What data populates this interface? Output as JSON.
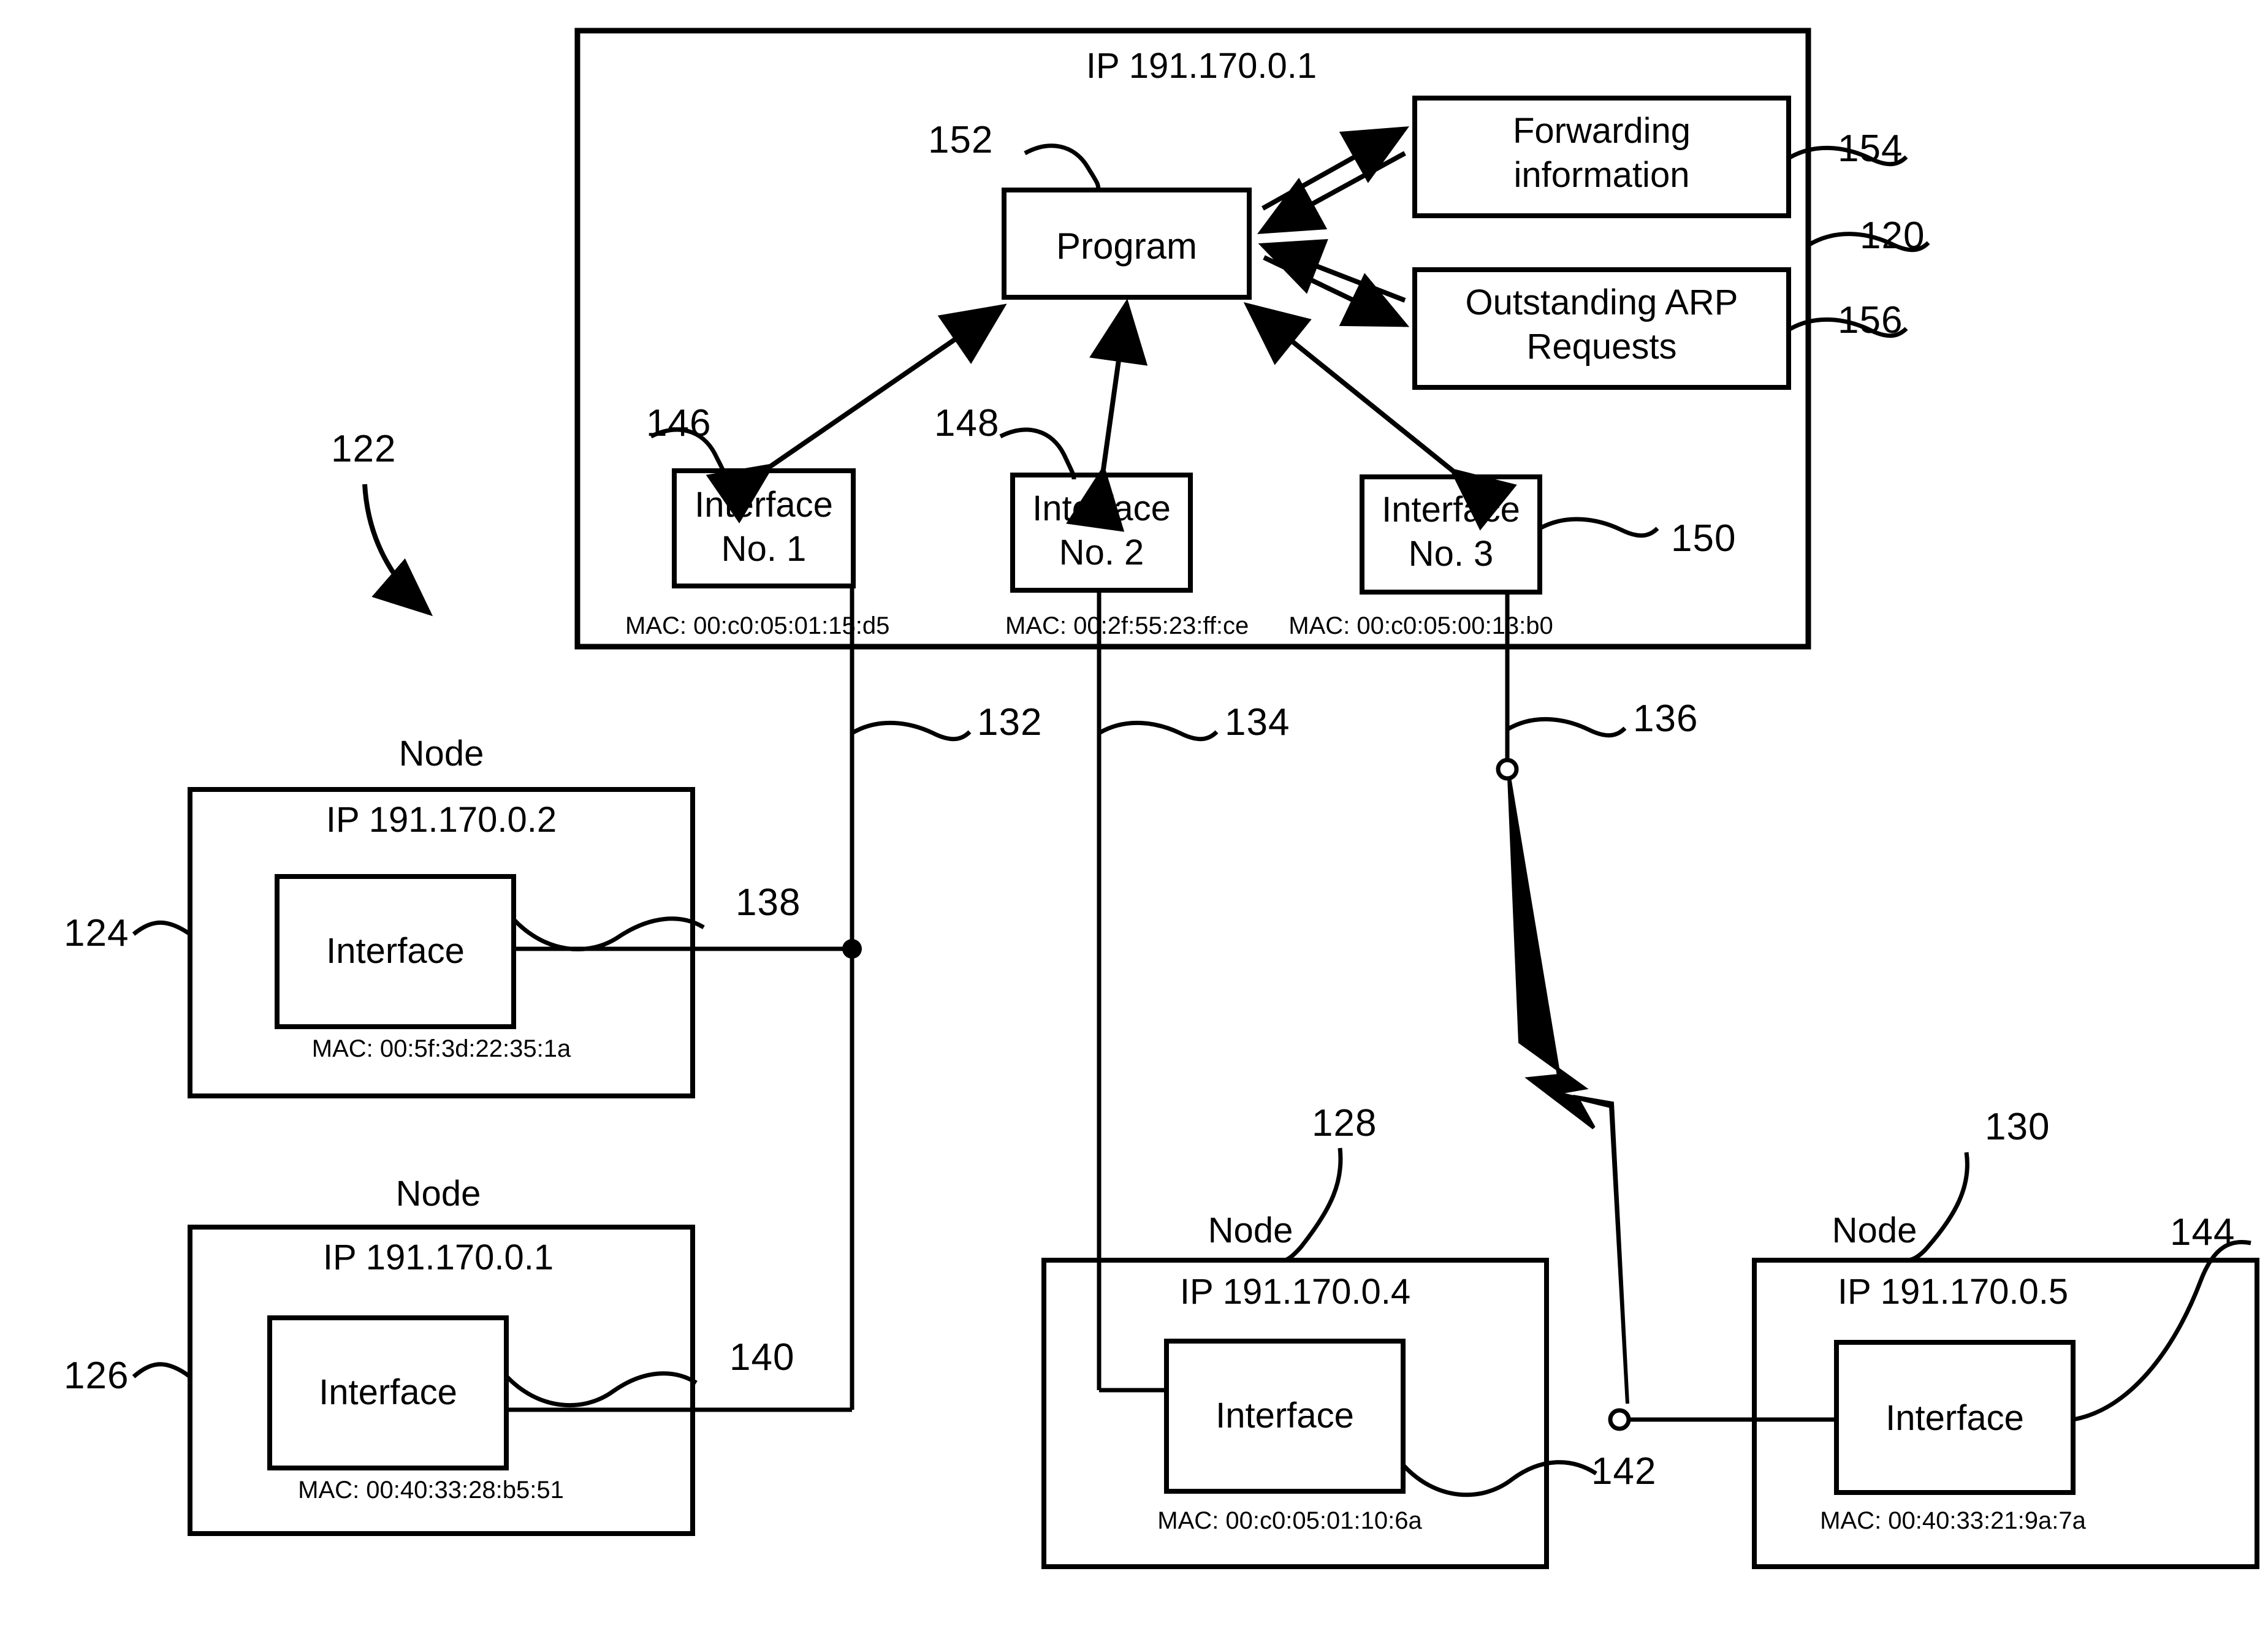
{
  "figure": {
    "router": {
      "ip_label": "IP 191.170.0.1",
      "ref": "120",
      "program_box": {
        "label": "Program",
        "ref": "152"
      },
      "forwarding_box": {
        "line1": "Forwarding",
        "line2": "information",
        "ref": "154"
      },
      "arp_box": {
        "line1": "Outstanding ARP",
        "line2": "Requests",
        "ref": "156"
      },
      "interfaces": [
        {
          "line1": "Interface",
          "line2": "No. 1",
          "ref": "146",
          "mac": "MAC: 00:c0:05:01:15:d5"
        },
        {
          "line1": "Interface",
          "line2": "No. 2",
          "ref": "148",
          "mac": "MAC: 00:2f:55:23:ff:ce"
        },
        {
          "line1": "Interface",
          "line2": "No. 3",
          "ref": "150",
          "mac": "MAC: 00:c0:05:00:13:b0"
        }
      ]
    },
    "system_ref": "122",
    "links": [
      {
        "ref": "132"
      },
      {
        "ref": "134"
      },
      {
        "ref": "136"
      }
    ],
    "nodes": [
      {
        "title": "Node",
        "ip": "IP 191.170.0.2",
        "interface_label": "Interface",
        "mac": "MAC: 00:5f:3d:22:35:1a",
        "node_ref": "124",
        "iface_ref": "138"
      },
      {
        "title": "Node",
        "ip": "IP 191.170.0.1",
        "interface_label": "Interface",
        "mac": "MAC: 00:40:33:28:b5:51",
        "node_ref": "126",
        "iface_ref": "140"
      },
      {
        "title": "Node",
        "ip": "IP 191.170.0.4",
        "interface_label": "Interface",
        "mac": "MAC: 00:c0:05:01:10:6a",
        "node_ref": "128",
        "iface_ref": "142"
      },
      {
        "title": "Node",
        "ip": "IP 191.170.0.5",
        "interface_label": "Interface",
        "mac": "MAC: 00:40:33:21:9a:7a",
        "node_ref": "130",
        "iface_ref": "144"
      }
    ]
  },
  "colors": {
    "ink": "#000000",
    "paper": "#ffffff"
  }
}
